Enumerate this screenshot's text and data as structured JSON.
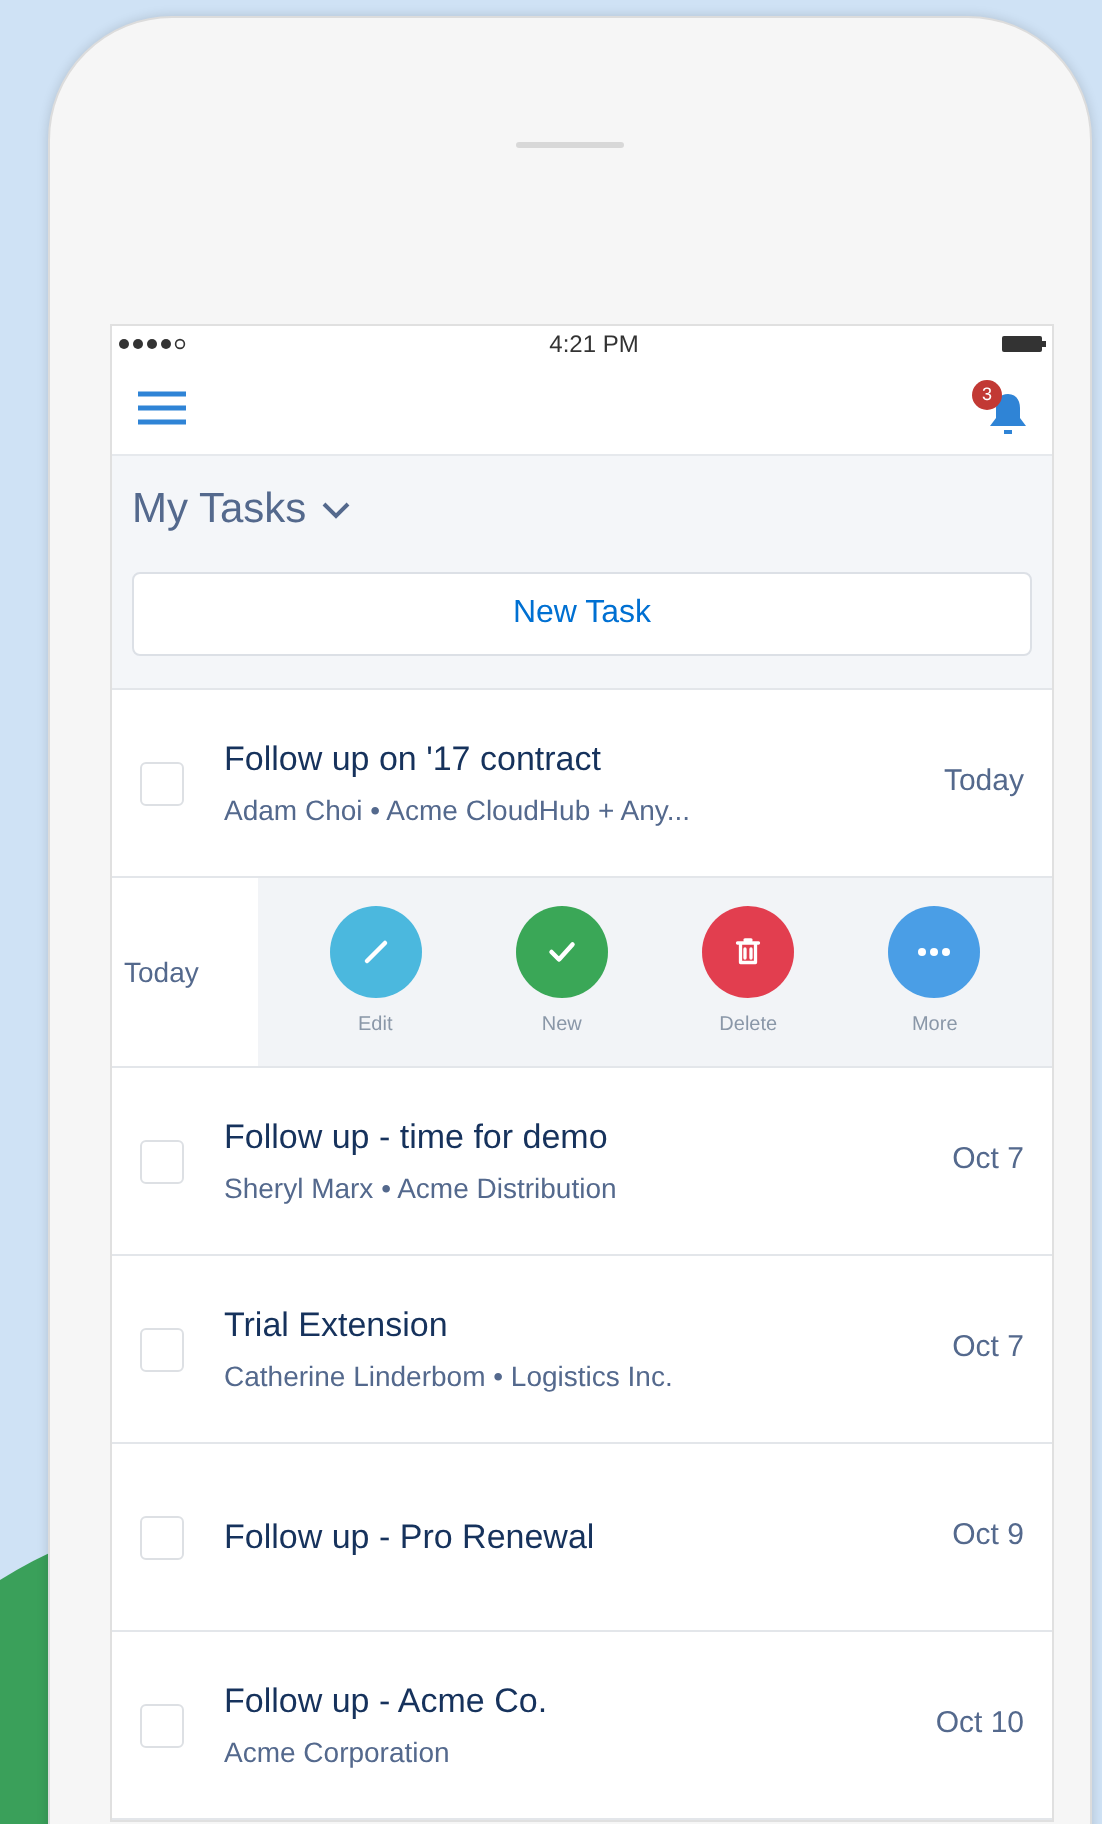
{
  "status_bar": {
    "time": "4:21 PM"
  },
  "notifications": {
    "count": "3"
  },
  "header": {
    "title": "My Tasks"
  },
  "new_task_button": {
    "label": "New Task"
  },
  "tasks": [
    {
      "kind": "task",
      "title": "Follow up on '17 contract",
      "subtitle": "Adam Choi • Acme CloudHub + Any...",
      "date": "Today",
      "checked": false
    },
    {
      "kind": "swiped",
      "date": "Today",
      "actions": [
        {
          "kind": "edit",
          "label": "Edit",
          "color": "#4bb8de"
        },
        {
          "kind": "check",
          "label": "New",
          "color": "#3aa757"
        },
        {
          "kind": "delete",
          "label": "Delete",
          "color": "#e23e4f"
        },
        {
          "kind": "more",
          "label": "More",
          "color": "#4a9ee6"
        }
      ]
    },
    {
      "kind": "task",
      "title": "Follow up - time for demo",
      "subtitle": "Sheryl Marx • Acme Distribution",
      "date": "Oct 7",
      "checked": false
    },
    {
      "kind": "task",
      "title": "Trial Extension",
      "subtitle": "Catherine Linderbom • Logistics Inc.",
      "date": "Oct 7",
      "checked": false
    },
    {
      "kind": "task",
      "title": "Follow up - Pro Renewal",
      "date": "Oct 9",
      "checked": false
    },
    {
      "kind": "task",
      "title": "Follow up - Acme Co.",
      "subtitle": "Acme Corporation",
      "date": "Oct 10",
      "checked": false
    }
  ]
}
